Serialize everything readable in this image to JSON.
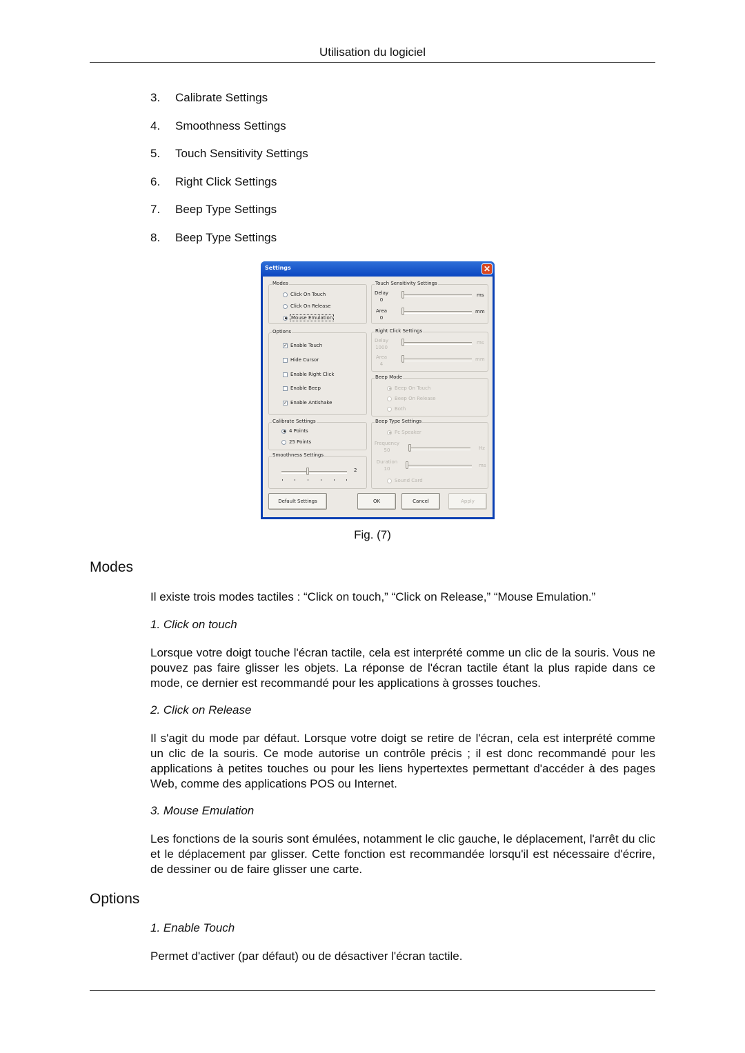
{
  "header": {
    "title": "Utilisation du logiciel"
  },
  "list": [
    {
      "num": "3.",
      "label": "Calibrate Settings"
    },
    {
      "num": "4.",
      "label": "Smoothness Settings"
    },
    {
      "num": "5.",
      "label": "Touch Sensitivity Settings"
    },
    {
      "num": "6.",
      "label": "Right Click Settings"
    },
    {
      "num": "7.",
      "label": "Beep Type Settings"
    },
    {
      "num": "8.",
      "label": "Beep Type Settings"
    }
  ],
  "dialog": {
    "title": "Settings",
    "close_icon": "close-icon",
    "modes": {
      "label": "Modes",
      "options": [
        {
          "label": "Click On Touch",
          "selected": false
        },
        {
          "label": "Click On Release",
          "selected": false
        },
        {
          "label": "Mouse Emulation",
          "selected": true
        }
      ]
    },
    "options": {
      "label": "Options",
      "items": [
        {
          "label": "Enable Touch",
          "checked": true
        },
        {
          "label": "Hide Cursor",
          "checked": false
        },
        {
          "label": "Enable Right Click",
          "checked": false
        },
        {
          "label": "Enable Beep",
          "checked": false
        },
        {
          "label": "Enable Antishake",
          "checked": true
        }
      ]
    },
    "calibrate": {
      "label": "Calibrate Settings",
      "options": [
        {
          "label": "4 Points",
          "selected": true
        },
        {
          "label": "25 Points",
          "selected": false
        }
      ]
    },
    "smoothness": {
      "label": "Smoothness Settings",
      "value": "2",
      "level_fraction": 0.4
    },
    "touch_sensitivity": {
      "label": "Touch Sensitivity Settings",
      "delay": {
        "label": "Delay",
        "value": "0",
        "unit": "ms"
      },
      "area": {
        "label": "Area",
        "value": "0",
        "unit": "mm"
      }
    },
    "right_click": {
      "label": "Right Click Settings",
      "delay": {
        "label": "Delay",
        "value": "1000",
        "unit": "ms"
      },
      "area": {
        "label": "Area",
        "value": "4",
        "unit": "mm"
      }
    },
    "beep_mode": {
      "label": "Beep Mode",
      "options": [
        {
          "label": "Beep On Touch",
          "selected": true
        },
        {
          "label": "Beep On Release",
          "selected": false
        },
        {
          "label": "Both",
          "selected": false
        }
      ]
    },
    "beep_type": {
      "label": "Beep Type Settings",
      "pc_speaker": "Pc Speaker",
      "frequency": {
        "label": "Frequency",
        "value": "50",
        "unit": "Hz"
      },
      "duration": {
        "label": "Duration",
        "value": "10",
        "unit": "ms"
      },
      "sound_card": "Sound Card"
    },
    "buttons": {
      "default": "Default Settings",
      "ok": "OK",
      "cancel": "Cancel",
      "apply": "Apply"
    }
  },
  "figure_caption": "Fig. (7)",
  "sections": {
    "modes_heading": "Modes",
    "modes_intro": "Il existe trois modes tactiles : “Click on touch,” “Click on Release,” “Mouse Emulation.”",
    "click_on_touch_title": "1. Click on touch",
    "click_on_touch_text": "Lorsque votre doigt touche l'écran tactile, cela est interprété comme un clic de la souris. Vous ne pouvez pas faire glisser les objets. La réponse de l'écran tactile étant la plus rapide dans ce mode, ce dernier est recommandé pour les applications à grosses touches.",
    "click_on_release_title": "2. Click on Release",
    "click_on_release_text": "Il s'agit du mode par défaut. Lorsque votre doigt se retire de l'écran, cela est interprété comme un clic de la souris. Ce mode autorise un contrôle précis ; il est donc recommandé pour les applications à petites touches ou pour les liens hypertextes permettant d'accéder à des pages Web, comme des applications POS ou Internet.",
    "mouse_emulation_title": "3. Mouse Emulation",
    "mouse_emulation_text": "Les fonctions de la souris sont émulées, notamment le clic gauche, le déplacement, l'arrêt du clic et le déplacement par glisser. Cette fonction est recommandée lorsqu'il est nécessaire d'écrire, de dessiner ou de faire glisser une carte.",
    "options_heading": "Options",
    "enable_touch_title": "1. Enable Touch",
    "enable_touch_text": "Permet d'activer (par défaut) ou de désactiver l'écran tactile."
  }
}
